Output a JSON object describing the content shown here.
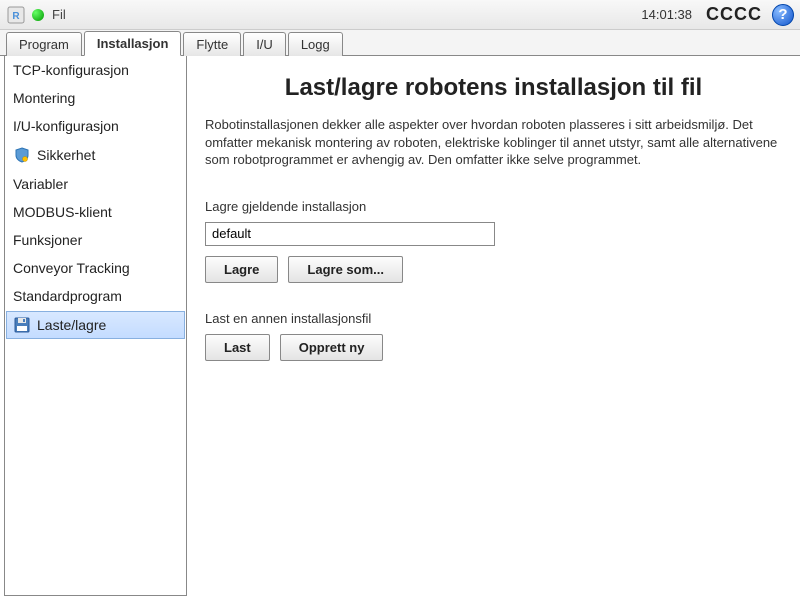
{
  "topbar": {
    "fil": "Fil",
    "time": "14:01:38",
    "status": "CCCC"
  },
  "tabs": [
    {
      "label": "Program",
      "active": false
    },
    {
      "label": "Installasjon",
      "active": true
    },
    {
      "label": "Flytte",
      "active": false
    },
    {
      "label": "I/U",
      "active": false
    },
    {
      "label": "Logg",
      "active": false
    }
  ],
  "sidebar": {
    "items": [
      {
        "label": "TCP-konfigurasjon",
        "icon": null
      },
      {
        "label": "Montering",
        "icon": null
      },
      {
        "label": "I/U-konfigurasjon",
        "icon": null
      },
      {
        "label": "Sikkerhet",
        "icon": "shield"
      },
      {
        "label": "Variabler",
        "icon": null
      },
      {
        "label": "MODBUS-klient",
        "icon": null
      },
      {
        "label": "Funksjoner",
        "icon": null
      },
      {
        "label": "Conveyor Tracking",
        "icon": null
      },
      {
        "label": "Standardprogram",
        "icon": null
      },
      {
        "label": "Laste/lagre",
        "icon": "disk",
        "selected": true
      }
    ]
  },
  "main": {
    "title": "Last/lagre robotens installasjon til fil",
    "description": "Robotinstallasjonen dekker alle aspekter over hvordan roboten plasseres i sitt arbeidsmiljø. Det omfatter mekanisk montering av roboten, elektriske koblinger til annet utstyr, samt alle alternativene som robotprogrammet er avhengig av. Den omfatter ikke selve programmet.",
    "save_section_label": "Lagre gjeldende installasjon",
    "filename_value": "default",
    "save_button": "Lagre",
    "save_as_button": "Lagre som...",
    "load_section_label": "Last en annen installasjonsfil",
    "load_button": "Last",
    "create_new_button": "Opprett ny"
  }
}
